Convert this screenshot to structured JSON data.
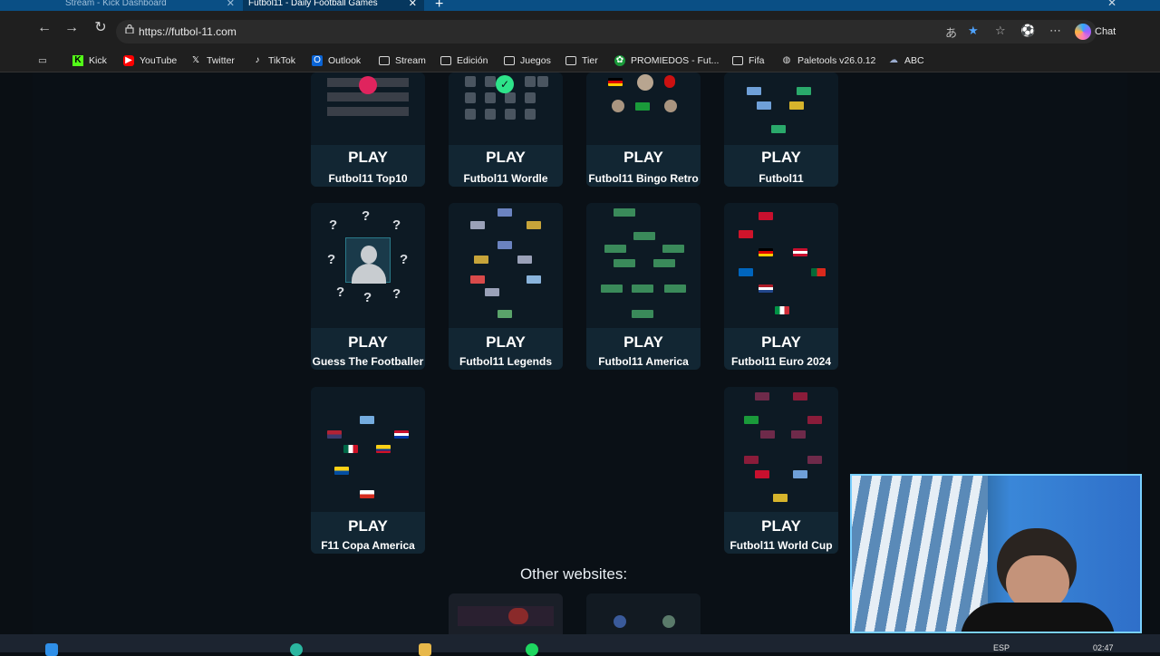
{
  "browser": {
    "tabs": [
      {
        "label": "Stream - Kick Dashboard",
        "active": false
      },
      {
        "label": "Futbol11 - Daily Football Games",
        "active": true
      }
    ],
    "url": "https://futbol-11.com",
    "chat_label": "Chat",
    "bookmarks": [
      {
        "label": "Kick",
        "icon": "kick-icon",
        "kind": "site"
      },
      {
        "label": "YouTube",
        "icon": "youtube-icon",
        "kind": "site"
      },
      {
        "label": "Twitter",
        "icon": "x-icon",
        "kind": "site"
      },
      {
        "label": "TikTok",
        "icon": "tiktok-icon",
        "kind": "site"
      },
      {
        "label": "Outlook",
        "icon": "outlook-icon",
        "kind": "site"
      },
      {
        "label": "Stream",
        "icon": "folder-icon",
        "kind": "folder"
      },
      {
        "label": "Edición",
        "icon": "folder-icon",
        "kind": "folder"
      },
      {
        "label": "Juegos",
        "icon": "folder-icon",
        "kind": "folder"
      },
      {
        "label": "Tier",
        "icon": "folder-icon",
        "kind": "folder"
      },
      {
        "label": "PROMIEDOS - Fut...",
        "icon": "promiedos-icon",
        "kind": "site"
      },
      {
        "label": "Fifa",
        "icon": "folder-icon",
        "kind": "folder"
      },
      {
        "label": "Paletools v26.0.12",
        "icon": "globe-icon",
        "kind": "site"
      },
      {
        "label": "ABC",
        "icon": "cloud-icon",
        "kind": "site"
      }
    ]
  },
  "games": [
    {
      "play": "PLAY",
      "title": "Futbol11 Top10"
    },
    {
      "play": "PLAY",
      "title": "Futbol11 Wordle"
    },
    {
      "play": "PLAY",
      "title": "Futbol11 Bingo Retro"
    },
    {
      "play": "PLAY",
      "title": "Futbol11"
    },
    {
      "play": "PLAY",
      "title": "Guess The Footballer"
    },
    {
      "play": "PLAY",
      "title": "Futbol11 Legends"
    },
    {
      "play": "PLAY",
      "title": "Futbol11 America"
    },
    {
      "play": "PLAY",
      "title": "Futbol11 Euro 2024"
    },
    {
      "play": "PLAY",
      "title": "F11 Copa America"
    },
    {
      "play": "PLAY",
      "title": "Futbol11 World Cup"
    }
  ],
  "other_websites": "Other websites:",
  "taskbar": {
    "lang": "ESP",
    "time": "02:47"
  },
  "colors": {
    "accent": "#2ee48a",
    "card": "#0f1c26",
    "card_footer": "#122633",
    "page_bg": "#0a1016"
  }
}
